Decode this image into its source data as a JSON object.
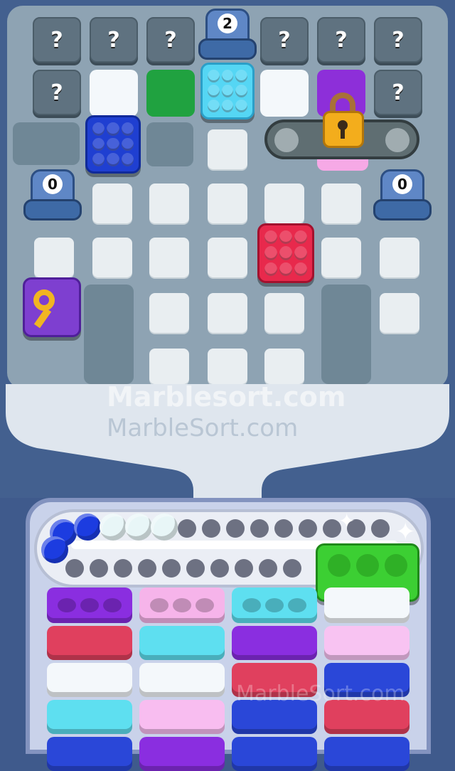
{
  "game": {
    "mystery_glyph": "?",
    "tunnels": [
      {
        "id": "top",
        "count": "2"
      },
      {
        "id": "left",
        "count": "0"
      },
      {
        "id": "right",
        "count": "0"
      }
    ],
    "board_blocks": [
      {
        "id": "cyan",
        "color": "#55d6f4"
      },
      {
        "id": "blue",
        "color": "#1f3fd1"
      },
      {
        "id": "red",
        "color": "#e8294c"
      }
    ],
    "key_block_color": "#7e3fd0",
    "lock_color": "#f3ad1c",
    "placed_cells": [
      {
        "id": "white",
        "color": "#f4f8fb"
      },
      {
        "id": "green",
        "color": "#20a240"
      },
      {
        "id": "white-2",
        "color": "#f4f8fb"
      },
      {
        "id": "purple",
        "color": "#8d2fd9"
      },
      {
        "id": "pink",
        "color": "#f6a9e6"
      }
    ],
    "conveyor": {
      "balls": [
        {
          "color": "#1c3ce0"
        },
        {
          "color": "#1c3ce0"
        },
        {
          "color": "#1c3ce0"
        },
        {
          "color": "#e8f6f7"
        },
        {
          "color": "#e8f6f7"
        },
        {
          "color": "#e8f6f7"
        }
      ],
      "incoming_block_color": "#3ccf33"
    },
    "stacks": [
      {
        "top": "#8a2ee0",
        "layers": [
          "#e0405e",
          "#f4f8fb",
          "#5edff0",
          "#2a47d8"
        ]
      },
      {
        "top": "#f6b4ea",
        "layers": [
          "#5edff0",
          "#f4f8fb",
          "#f8bdf0",
          "#8a2ee0"
        ]
      },
      {
        "top": "#5edff0",
        "layers": [
          "#8a2ee0",
          "#e0405e",
          "#2a47d8",
          "#2a47d8"
        ]
      },
      {
        "top": "#f4f8fb",
        "layers": [
          "#f8c3f2",
          "#2a47d8",
          "#e0405e",
          "#2a47d8"
        ]
      }
    ]
  },
  "watermarks": {
    "primary": "Marblesort.com",
    "secondary": "MarbleSort.com",
    "tertiary": "MarbleSort.com"
  }
}
